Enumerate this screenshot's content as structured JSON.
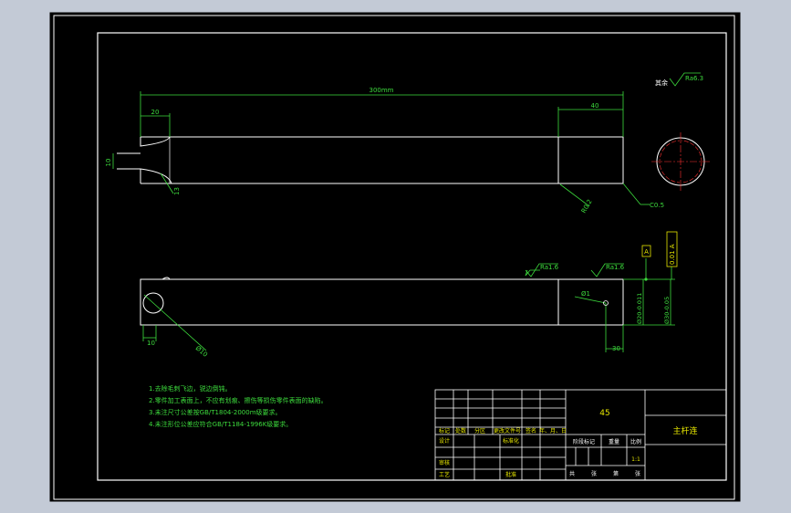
{
  "colors": {
    "background": "#c3cad6",
    "sheet": "#000000",
    "outline": "#ffffff",
    "dimension": "#3ddc3d",
    "note": "#e6e600",
    "center_line": "#ff3030",
    "datum": "#e6e600"
  },
  "top_view": {
    "overall_length": "300mm",
    "left_step_width": "20",
    "right_block_width": "40",
    "left_height": "10",
    "slot_note": "13",
    "radius_label": "R0.2",
    "chamfer": "C0.5"
  },
  "surface_finish": {
    "general": "其余",
    "general_value": "Ra6.3",
    "finish_1": "Ra1.6",
    "finish_2": "Ra1.6"
  },
  "front_view": {
    "hole_dia": "Ø1",
    "bore_dia": "Ø10",
    "left_offset": "10",
    "bottom_width": "30",
    "height_tol_1": "Ø20-0.011",
    "height_tol_2": "Ø30-0.05",
    "datum_label": "A",
    "tolerance_frame": "0.01 A"
  },
  "notes": [
    "1.去除毛刺飞边，锐边倒钝。",
    "2.零件加工表面上，不应有划痕、擦伤等损伤零件表面的缺陷。",
    "3.未注尺寸公差按GB/T1804-2000m级要求。",
    "4.未注形位公差应符合GB/T1184-1996K级要求。"
  ],
  "title_block": {
    "material": "45",
    "part_name": "主杆连",
    "scale": "1:1",
    "rev_headers": [
      "标记",
      "处数",
      "分区",
      "更改文件号",
      "签名",
      "年、月、日"
    ],
    "designer": "设计",
    "standardize": "标准化",
    "reviewer": "审核",
    "process": "工艺",
    "approve": "批准",
    "stage_mark": "阶段标记",
    "weight": "重量",
    "ratio": "比例",
    "sheets_total": "共",
    "sheets_unit": "张",
    "sheet_no": "第",
    "sheet_unit": "张"
  }
}
